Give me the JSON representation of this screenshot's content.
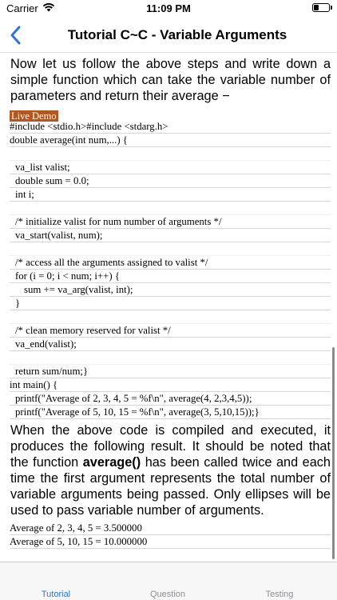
{
  "status": {
    "carrier": "Carrier",
    "time": "11:09 PM"
  },
  "nav": {
    "title": "Tutorial C~C - Variable Arguments"
  },
  "content": {
    "intro": "Now let us follow the above steps and write down a simple function which can take the variable number of parameters and return their average −",
    "live_demo": "Live Demo",
    "code_lines": [
      "#include <stdio.h>#include <stdarg.h>",
      "double average(int num,...) {",
      "",
      "va_list valist;",
      "double sum = 0.0;",
      "int i;",
      "",
      "/* initialize valist for num number of arguments */",
      "va_start(valist, num);",
      "",
      "/* access all the arguments assigned to valist */",
      "for (i = 0; i < num; i++) {",
      "sum += va_arg(valist, int);",
      "}",
      "",
      "/* clean memory reserved for valist */",
      "va_end(valist);",
      "",
      "return sum/num;}",
      "int main() {",
      "printf(\"Average of 2, 3, 4, 5 = %f\\n\", average(4, 2,3,4,5));",
      "printf(\"Average of 5, 10, 15 = %f\\n\", average(3, 5,10,15));}"
    ],
    "result_before": "When the above code is compiled and executed, it produces the following result. It should be noted that the function ",
    "result_bold": "average()",
    "result_after": " has been called twice and each time the first argument represents the total number of variable arguments being passed. Only ellipses will be used to pass variable number of arguments.",
    "output_lines": [
      "Average of 2, 3, 4, 5 = 3.500000",
      "Average of 5, 10, 15 = 10.000000"
    ]
  },
  "tabs": {
    "tutorial": "Tutorial",
    "question": "Question",
    "testing": "Testing"
  },
  "colors": {
    "accent": "#2f74d9",
    "live_demo_bg": "#b3571e"
  }
}
